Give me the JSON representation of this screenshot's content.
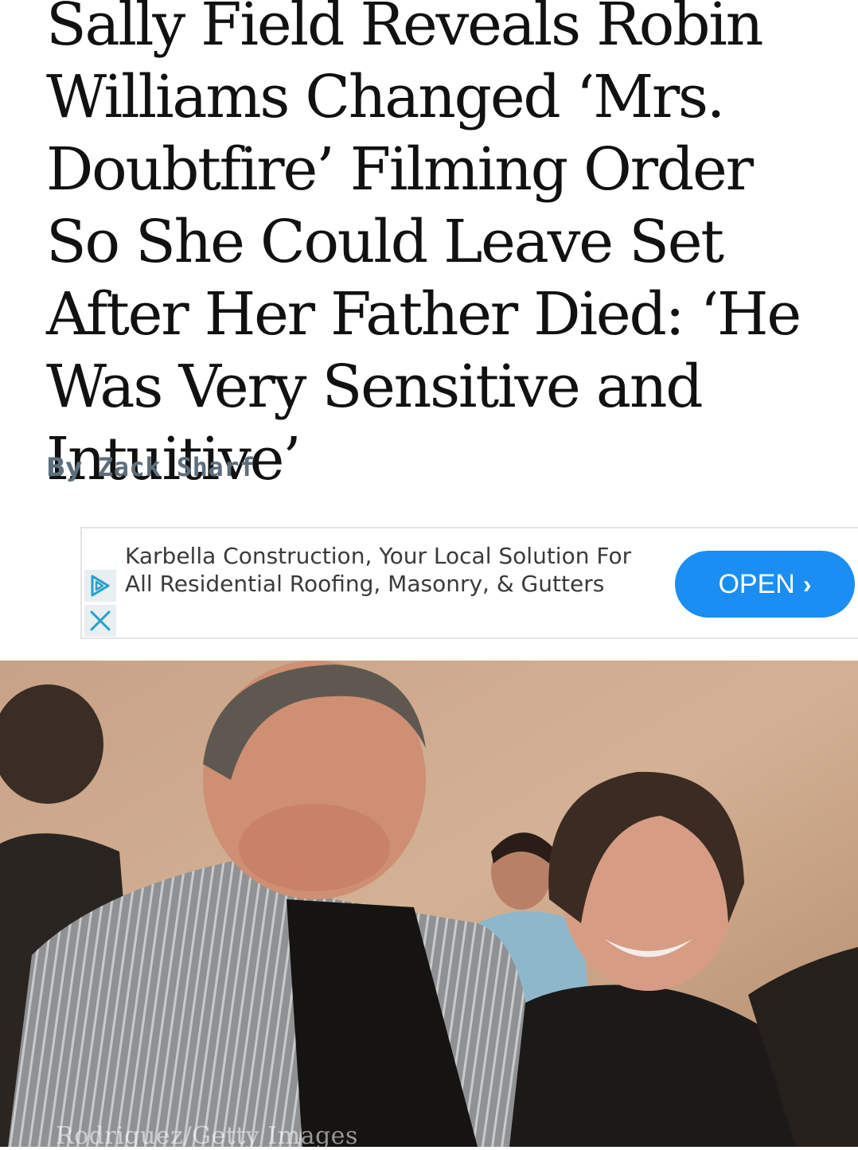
{
  "article": {
    "headline": "Sally Field Reveals Robin Williams Changed ‘Mrs. Doubtfire’ Filming Order So She Could Leave Set After Her Father Died: ‘He Was Very Sensitive and Intuitive’",
    "byline_prefix": "By",
    "author": "Zack Sharf",
    "photo_credit": "Rodriguez/Getty Images"
  },
  "ad": {
    "text": "Karbella Construction, Your Local Solution For All Residential Roofing, Masonry, & Gutters",
    "open_label": "OPEN",
    "open_icon": "chevron-right-icon",
    "choices_icon": "adchoices-icon",
    "close_icon": "close-icon",
    "button_color": "#1a8ef2"
  }
}
